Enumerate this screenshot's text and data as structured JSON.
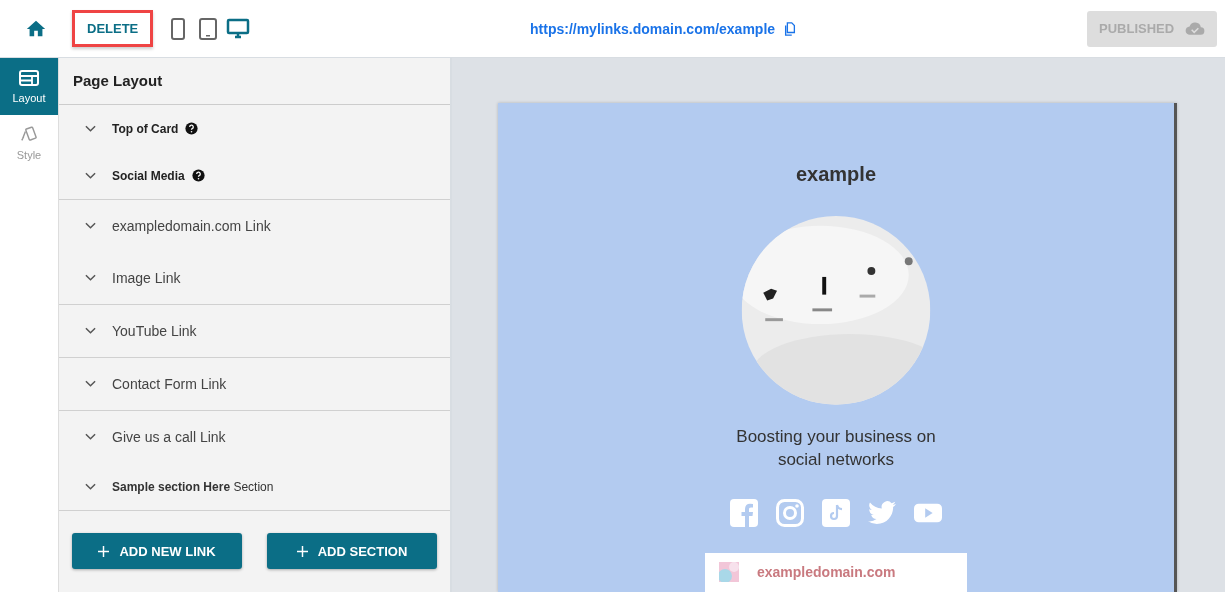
{
  "toolbar": {
    "delete_label": "DELETE",
    "devices": [
      {
        "kind": "phone",
        "selected": false
      },
      {
        "kind": "tablet",
        "selected": false
      },
      {
        "kind": "desktop",
        "selected": true
      }
    ],
    "url": "https://mylinks.domain.com/example",
    "publish": {
      "label": "PUBLISHED",
      "disabled": true
    }
  },
  "nav": [
    {
      "kind": "layout",
      "label": "Layout",
      "selected": true
    },
    {
      "kind": "style",
      "label": "Style",
      "selected": false
    }
  ],
  "panel": {
    "title": "Page Layout",
    "groups": [
      [
        {
          "kind": "setting",
          "label": "Top of Card",
          "help": true
        },
        {
          "kind": "setting",
          "label": "Social Media",
          "help": true
        }
      ],
      [
        {
          "kind": "link",
          "label": "exampledomain.com Link",
          "help": false
        },
        {
          "kind": "link",
          "label": "Image Link",
          "help": false
        }
      ],
      [
        {
          "kind": "link",
          "label": "YouTube Link",
          "help": false
        }
      ],
      [
        {
          "kind": "link",
          "label": "Contact Form Link",
          "help": false
        }
      ],
      [
        {
          "kind": "link",
          "label": "Give us a call Link",
          "help": false
        },
        {
          "kind": "section",
          "label": "**Sample section Here** Section",
          "help": false
        }
      ]
    ],
    "buttons": [
      "ADD NEW LINK",
      "ADD SECTION"
    ]
  },
  "preview": {
    "title": "example",
    "tagline": "Boosting your business on social networks",
    "socials": [
      {
        "kind": "facebook"
      },
      {
        "kind": "instagram"
      },
      {
        "kind": "tiktok"
      },
      {
        "kind": "twitter"
      },
      {
        "kind": "youtube"
      }
    ],
    "link_card": {
      "label": "exampledomain.com"
    }
  }
}
